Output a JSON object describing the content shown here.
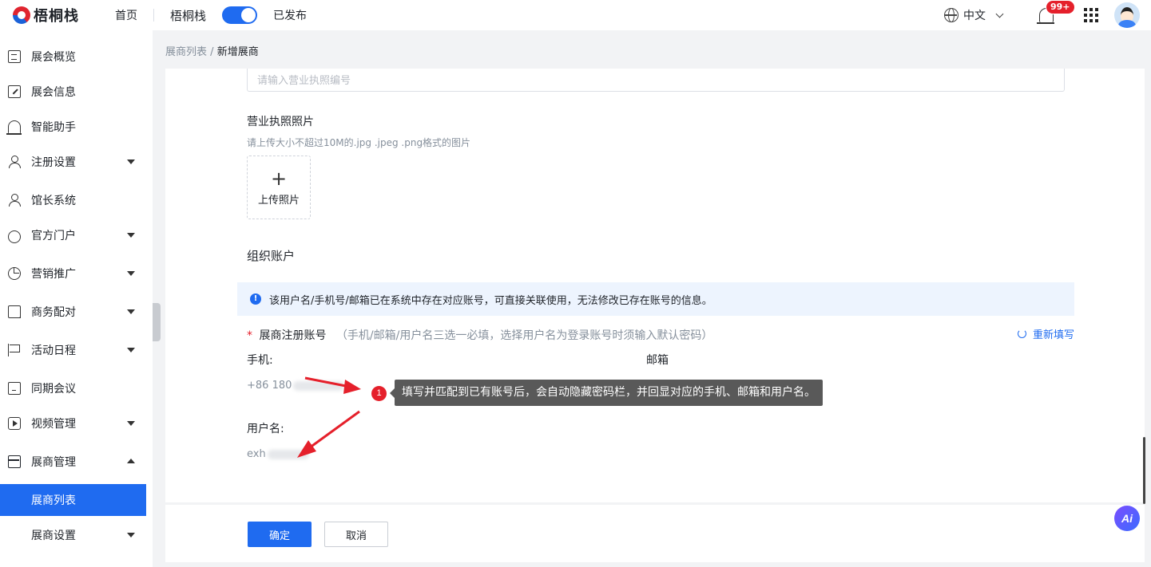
{
  "header": {
    "logo_text": "梧桐栈",
    "nav_home": "首页",
    "project_name": "梧桐栈",
    "publish_status": "已发布",
    "language": "中文",
    "notification_badge": "99+"
  },
  "sidebar": {
    "items": [
      {
        "label": "展会概览",
        "icon": "document-icon",
        "expandable": false
      },
      {
        "label": "展会信息",
        "icon": "edit-icon",
        "expandable": false
      },
      {
        "label": "智能助手",
        "icon": "bell-icon",
        "expandable": false
      },
      {
        "label": "注册设置",
        "icon": "user-icon",
        "expandable": true
      },
      {
        "label": "馆长系统",
        "icon": "user-icon",
        "expandable": false
      },
      {
        "label": "官方门户",
        "icon": "cloud-icon",
        "expandable": true
      },
      {
        "label": "营销推广",
        "icon": "pie-icon",
        "expandable": true
      },
      {
        "label": "商务配对",
        "icon": "copy-icon",
        "expandable": true
      },
      {
        "label": "活动日程",
        "icon": "flag-icon",
        "expandable": true
      },
      {
        "label": "同期会议",
        "icon": "note-icon",
        "expandable": false
      },
      {
        "label": "视频管理",
        "icon": "video-icon",
        "expandable": true
      },
      {
        "label": "展商管理",
        "icon": "store-icon",
        "expanded": true
      }
    ],
    "sub_items": [
      {
        "label": "展商列表",
        "active": true
      },
      {
        "label": "展商设置",
        "expandable": true
      }
    ]
  },
  "breadcrumb": {
    "parent": "展商列表",
    "separator": "/",
    "current": "新增展商"
  },
  "form": {
    "license_number_placeholder": "请输入营业执照编号",
    "license_photo_label": "营业执照照片",
    "license_photo_hint": "请上传大小不超过10M的.jpg .jpeg .png格式的图片",
    "upload_label": "上传照片",
    "org_account_title": "组织账户",
    "alert_text": "该用户名/手机号/邮箱已在系统中存在对应账号，可直接关联使用，无法修改已存在账号的信息。",
    "account_label": "展商注册账号",
    "account_hint": "（手机/邮箱/用户名三选一必填，选择用户名为登录账号时须输入默认密码）",
    "refill_label": "重新填写",
    "phone_label": "手机:",
    "phone_value": "+86 180",
    "email_label": "邮箱",
    "username_label": "用户名:",
    "username_value": "exh"
  },
  "annotation": {
    "number": "1",
    "text": "填写并匹配到已有账号后，会自动隐藏密码栏，并回显对应的手机、邮箱和用户名。"
  },
  "footer": {
    "confirm_label": "确定",
    "cancel_label": "取消"
  },
  "ai_button": "Ai",
  "colors": {
    "primary": "#1f6bf0",
    "alert_bg": "#edf4fe",
    "required": "#e5202b"
  }
}
